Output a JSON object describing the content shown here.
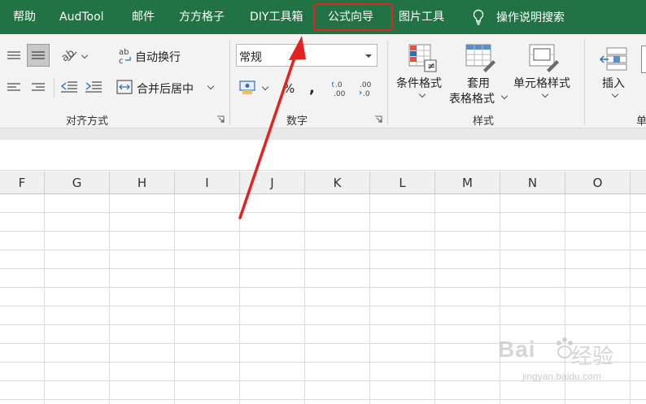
{
  "tabs": [
    {
      "label": "帮助"
    },
    {
      "label": "AudTool"
    },
    {
      "label": "邮件"
    },
    {
      "label": "方方格子"
    },
    {
      "label": "DIY工具箱"
    },
    {
      "label": "公式向导"
    },
    {
      "label": "图片工具"
    }
  ],
  "tell_me": {
    "label": "操作说明搜索",
    "icon": "lightbulb-icon"
  },
  "alignment": {
    "group_label": "对齐方式",
    "wrap_text": "自动换行",
    "merge_center": "合并后居中"
  },
  "number": {
    "group_label": "数字",
    "format_value": "常规",
    "percent": "%",
    "comma": ","
  },
  "styles": {
    "group_label": "样式",
    "conditional_format": "条件格式",
    "table_format_line1": "套用",
    "table_format_line2": "表格格式",
    "cell_styles": "单元格样式"
  },
  "cells": {
    "insert": "插入",
    "group_label_partial": "单"
  },
  "columns": [
    "F",
    "G",
    "H",
    "I",
    "J",
    "K",
    "L",
    "M",
    "N",
    "O"
  ],
  "watermark": {
    "brand": "Bai",
    "brand2": "经验",
    "url": "jingyan.baidu.com"
  },
  "colors": {
    "tab_bar": "#217346",
    "highlight": "#e3231f",
    "arrow": "#e3231f"
  }
}
